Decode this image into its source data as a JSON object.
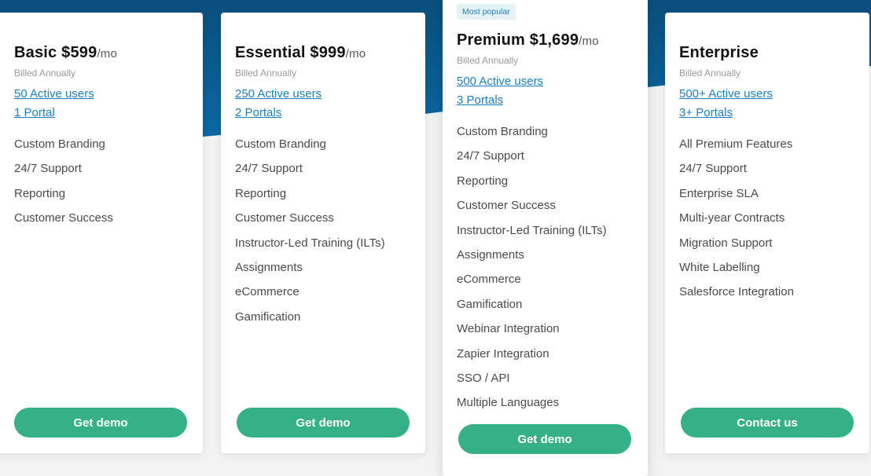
{
  "colors": {
    "brand_blue": "#0a5a8a",
    "link_blue": "#1a7fc1",
    "cta_green": "#36b087",
    "badge_bg": "#e6f2fa"
  },
  "plans": [
    {
      "name": "Basic",
      "price": "$599",
      "period": "/mo",
      "billing": "Billed Annually",
      "users": "50 Active users",
      "portals": "1 Portal",
      "features": [
        "Custom Branding",
        "24/7 Support",
        "Reporting",
        "Customer Success"
      ],
      "cta": "Get demo"
    },
    {
      "name": "Essential",
      "price": "$999",
      "period": "/mo",
      "billing": "Billed Annually",
      "users": "250 Active users",
      "portals": "2 Portals",
      "features": [
        "Custom Branding",
        "24/7 Support",
        "Reporting",
        "Customer Success",
        "Instructor-Led Training (ILTs)",
        "Assignments",
        "eCommerce",
        "Gamification"
      ],
      "cta": "Get demo"
    },
    {
      "badge": "Most popular",
      "name": "Premium",
      "price": "$1,699",
      "period": "/mo",
      "billing": "Billed Annually",
      "users": "500 Active users",
      "portals": "3 Portals",
      "features": [
        "Custom Branding",
        "24/7 Support",
        "Reporting",
        "Customer Success",
        "Instructor-Led Training (ILTs)",
        "Assignments",
        "eCommerce",
        "Gamification",
        "Webinar Integration",
        "Zapier Integration",
        "SSO / API",
        "Multiple Languages"
      ],
      "cta": "Get demo"
    },
    {
      "name": "Enterprise",
      "price": "",
      "period": "",
      "billing": "Billed Annually",
      "users": "500+ Active users",
      "portals": "3+ Portals",
      "features": [
        "All Premium Features",
        "24/7 Support",
        "Enterprise SLA",
        "Multi-year Contracts",
        "Migration Support",
        "White Labelling",
        "Salesforce Integration"
      ],
      "cta": "Contact us"
    }
  ]
}
